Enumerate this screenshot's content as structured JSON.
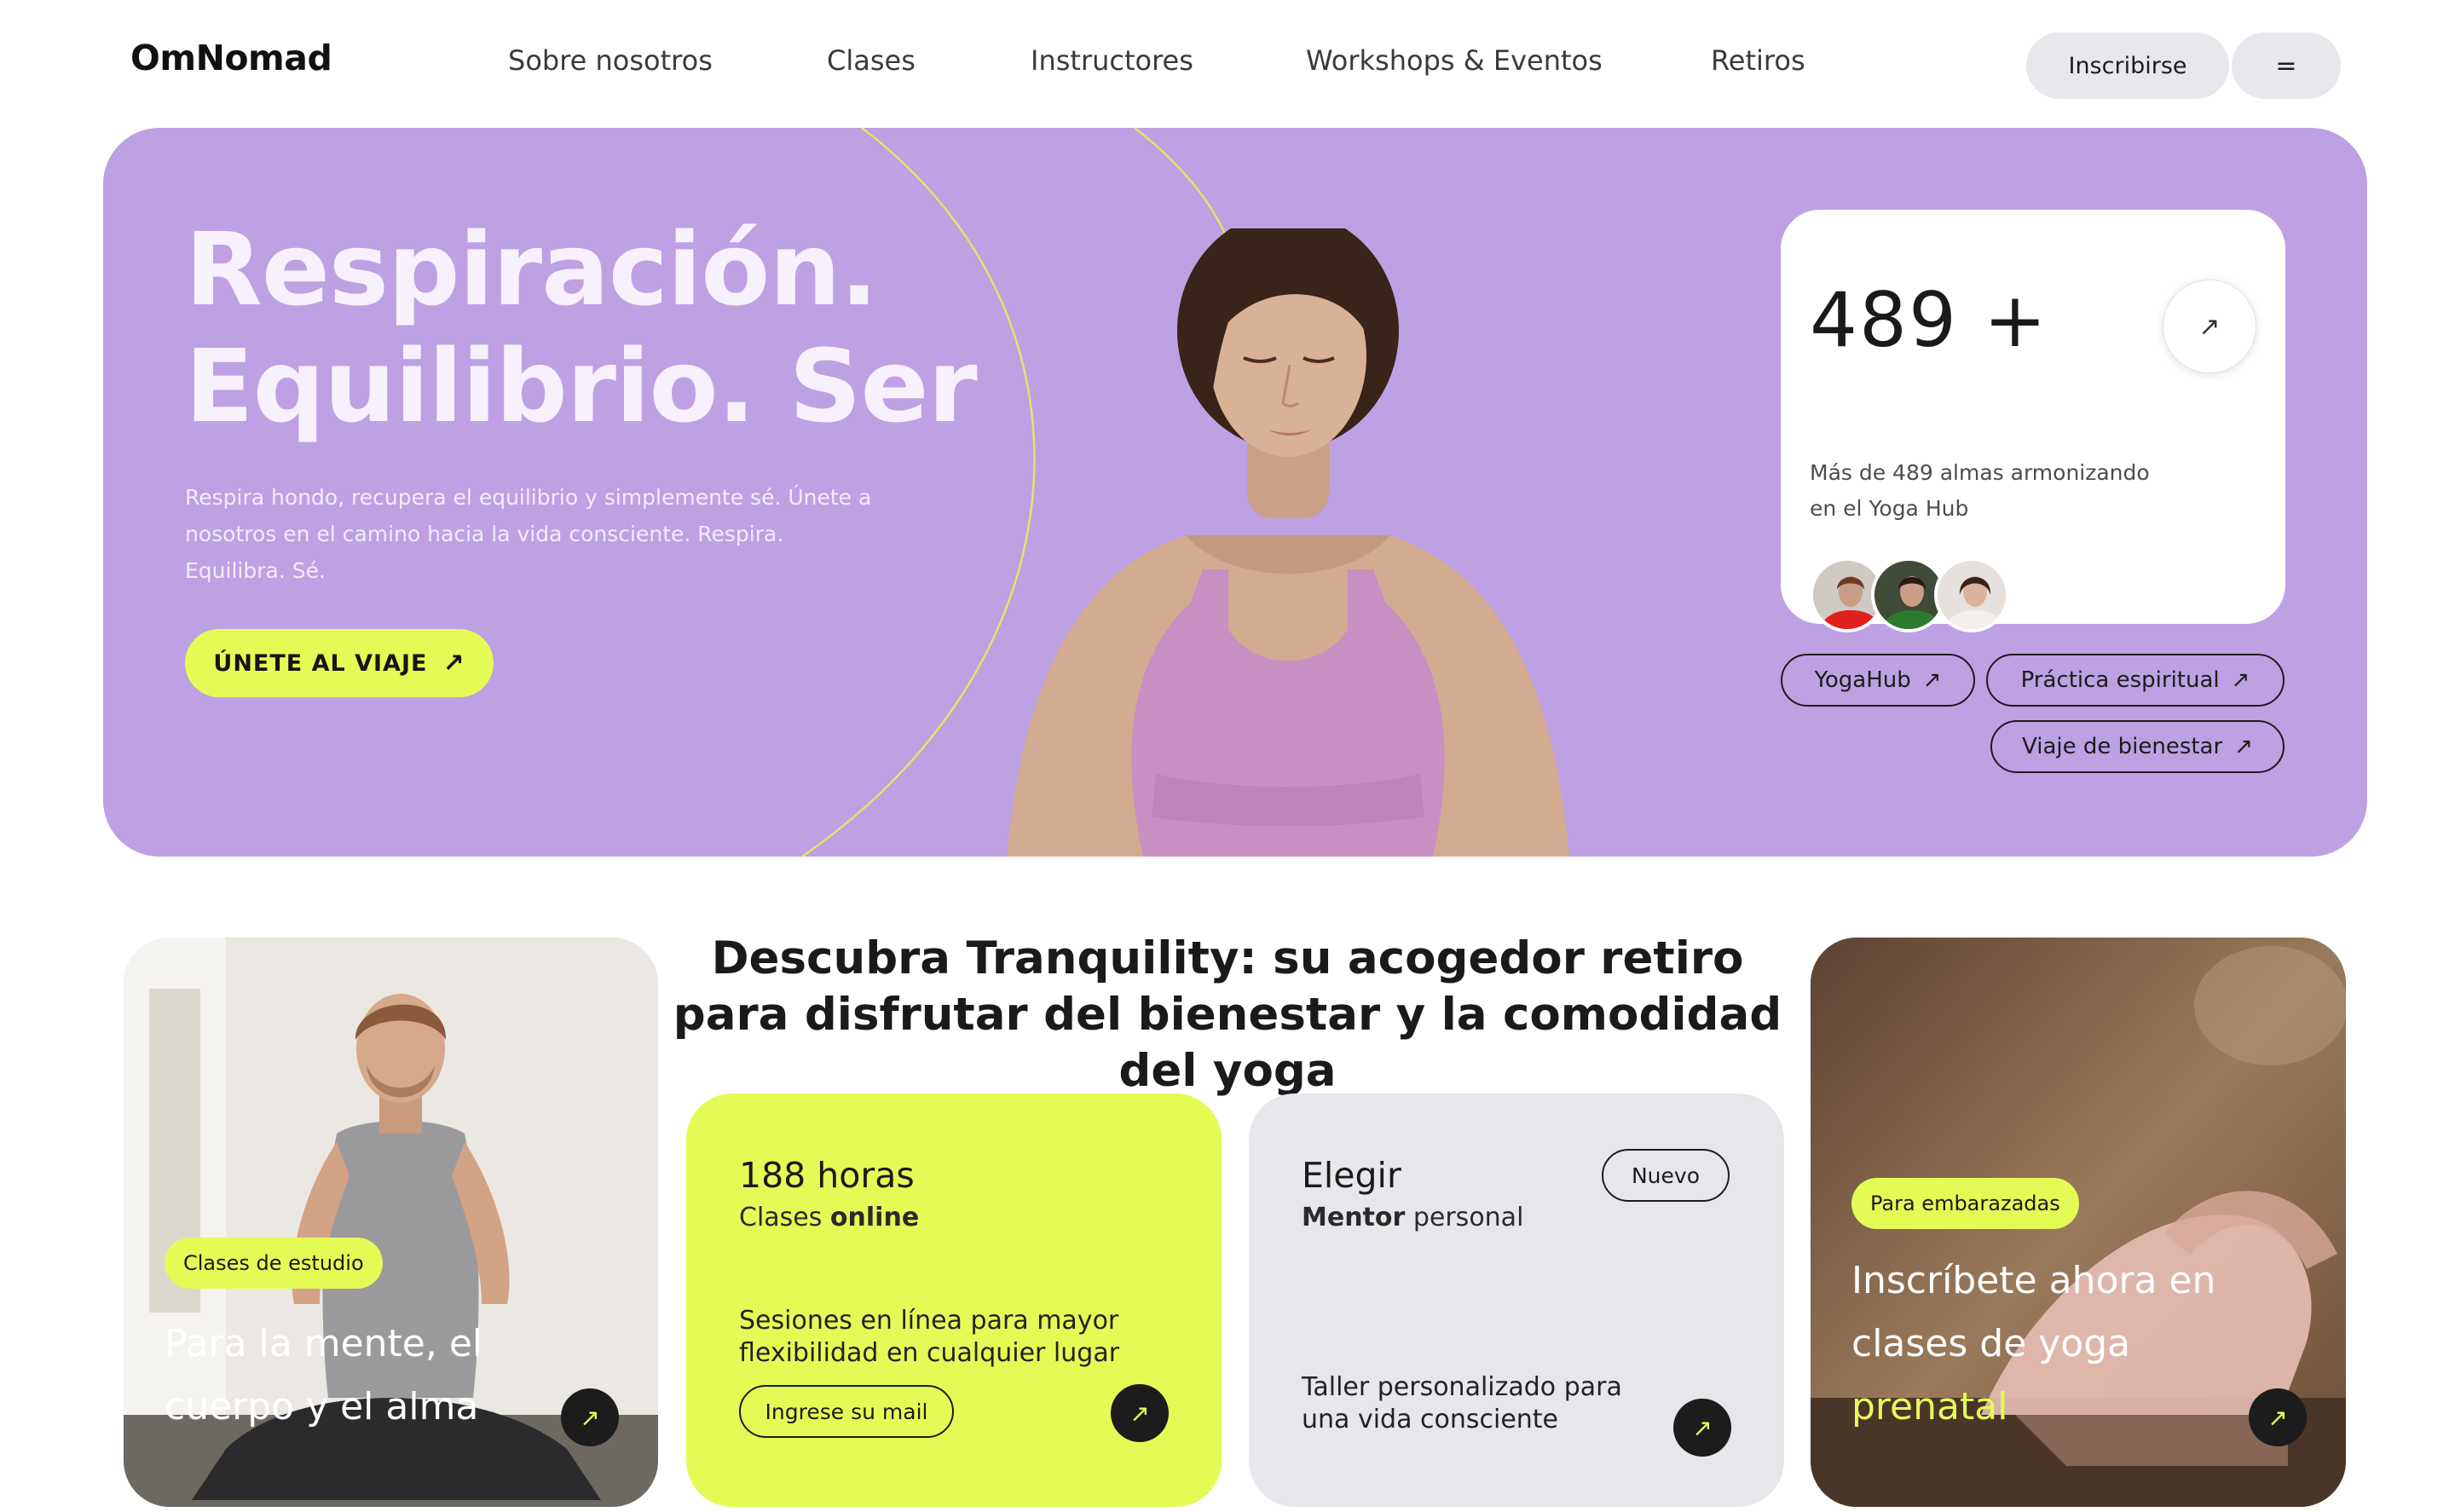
{
  "header": {
    "logo": "OmNomad",
    "nav": [
      "Sobre nosotros",
      "Clases",
      "Instructores",
      "Workshops & Eventos",
      "Retiros"
    ],
    "signup_label": "Inscribirse",
    "menu_icon": "="
  },
  "hero": {
    "title_line1": "Respiración.",
    "title_line2": "Equilibrio. Ser",
    "description": "Respira hondo, recupera el equilibrio y simplemente sé. Únete a nosotros en el camino hacia la vida consciente. Respira. Equilibra. Sé.",
    "cta_label": "ÚNETE AL VIAJE",
    "arrow": "↗",
    "stat": {
      "number": "489 +",
      "description": "Más de 489 almas armonizando en el Yoga Hub"
    },
    "tags": [
      "YogaHub",
      "Práctica espiritual",
      "Viaje de bienestar"
    ]
  },
  "section": {
    "title": "Descubra Tranquility: su acogedor retiro para disfrutar del bienestar y la comodidad del yoga"
  },
  "cards": {
    "study": {
      "badge": "Clases de estudio",
      "text": "Para la mente, el cuerpo y el alma"
    },
    "online": {
      "title": "188 horas",
      "sub_regular": "Clases ",
      "sub_bold": "online",
      "desc_regular": "Sesiones en línea para mayor flexibilidad en ",
      "desc_bold": "cualquier lugar",
      "mail_label": "Ingrese su mail"
    },
    "mentor": {
      "title": "Elegir",
      "sub_bold": "Mentor",
      "sub_regular": " personal",
      "badge": "Nuevo",
      "desc": "Taller personalizado para una vida consciente"
    },
    "prenatal": {
      "badge": "Para embarazadas",
      "text_regular": "Inscríbete ahora en clases de yoga ",
      "text_highlight": "prenatal"
    }
  },
  "colors": {
    "hero_bg": "#bda1e3",
    "accent": "#e5fb55",
    "card_gray": "#e6e7ea"
  }
}
